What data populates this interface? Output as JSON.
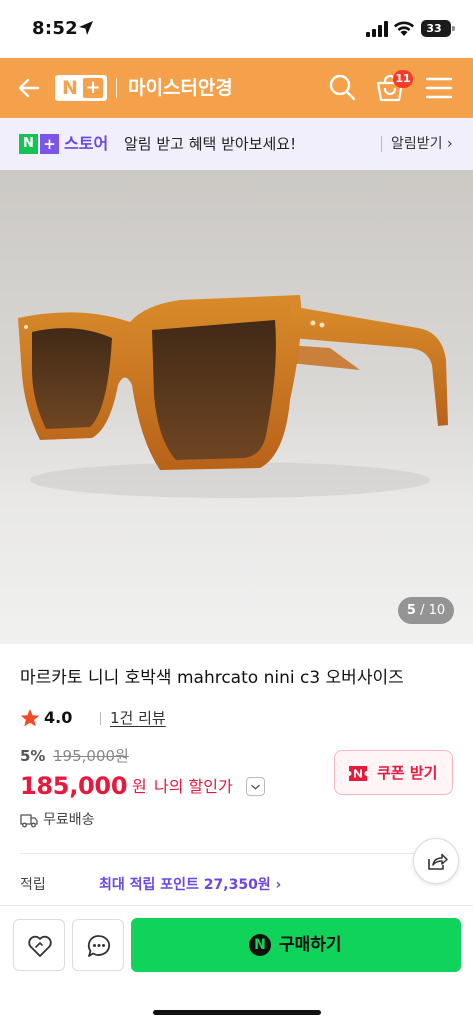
{
  "status_bar": {
    "time": "8:52",
    "battery": "33"
  },
  "header": {
    "brand_n": "N",
    "brand_plus": "+",
    "store_name": "마이스터안경",
    "cart_count": "11",
    "bg_color": "#f5a04a"
  },
  "promo": {
    "logo_n": "N",
    "logo_plus": "+",
    "store": "스토어",
    "text": "알림 받고 혜택 받아보세요!",
    "action": "알림받기 ›"
  },
  "gallery": {
    "current": "5",
    "total": "/ 10"
  },
  "product": {
    "title": "마르카토 니니 호박색 mahrcato nini c3 오버사이즈",
    "rating": "4.0",
    "reviews": "1건 리뷰",
    "discount": "5%",
    "original_price": "195,000원",
    "sale_price": "185,000",
    "sale_currency": "원",
    "my_discount": "나의 할인가",
    "coupon": "쿠폰 받기",
    "shipping": "무료배송",
    "points_label": "적립",
    "points_value": "최대 적립 포인트 27,350원 ›",
    "price_color": "#e8193c"
  },
  "bottom": {
    "buy_n": "N",
    "buy_label": "구매하기",
    "buy_color": "#0fd35a"
  }
}
